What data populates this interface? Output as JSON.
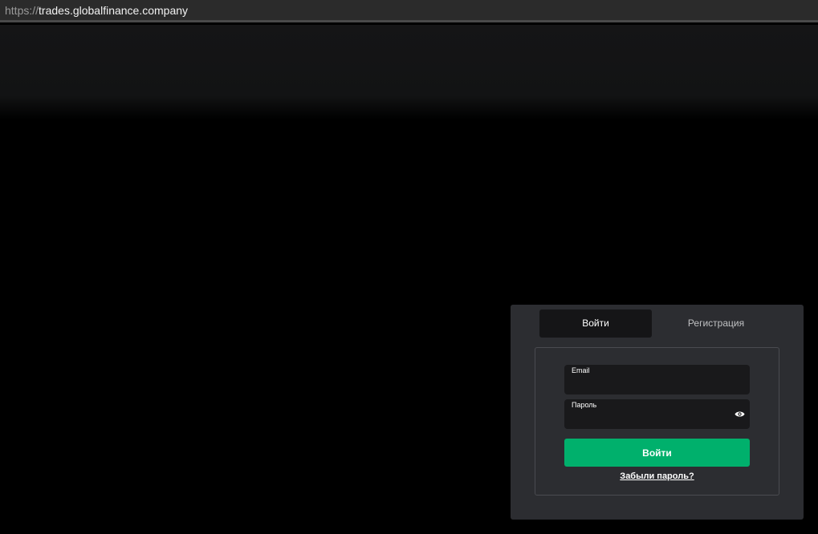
{
  "browser": {
    "url_scheme": "https://",
    "url_host": "trades.globalfinance.company"
  },
  "auth": {
    "tabs": [
      {
        "label": "Войти",
        "active": true
      },
      {
        "label": "Регистрация",
        "active": false
      }
    ],
    "email": {
      "label": "Email",
      "value": ""
    },
    "password": {
      "label": "Пароль",
      "value": "",
      "toggle_icon": "eye-icon"
    },
    "submit_label": "Войти",
    "forgot_label": "Забыли пароль?"
  },
  "colors": {
    "accent": "#00b06c",
    "panel": "#2c2d31",
    "field": "#19191b"
  }
}
